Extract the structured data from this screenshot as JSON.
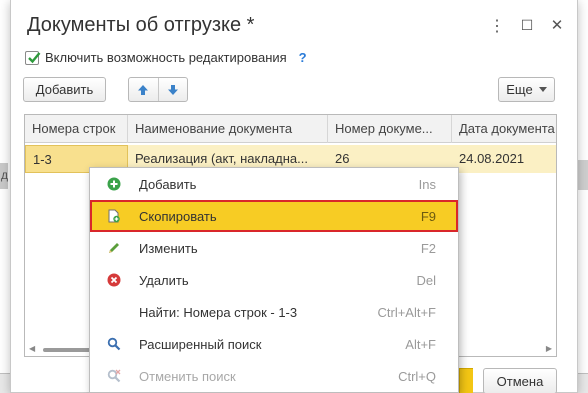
{
  "dialog": {
    "title": "Документы об отгрузке *",
    "window_buttons": {
      "more": "⋮",
      "maximize": "☐",
      "close": "✕"
    }
  },
  "options": {
    "enable_editing_label": "Включить возможность редактирования",
    "enable_editing_checked": true,
    "help_symbol": "?"
  },
  "toolbar": {
    "add_label": "Добавить",
    "more_label": "Еще",
    "more_icon": "caret-down-icon",
    "move_up_icon": "arrow-up-icon",
    "move_down_icon": "arrow-down-icon"
  },
  "table": {
    "columns": [
      "Номера строк",
      "Наименование документа",
      "Номер докуме...",
      "Дата документа"
    ],
    "rows": [
      [
        "1-3",
        "Реализация (акт, накладна...",
        "26",
        "24.08.2021"
      ]
    ]
  },
  "background": {
    "left_fragment": "д"
  },
  "buttons": {
    "cancel_label": "Отмена"
  },
  "context_menu": {
    "items": [
      {
        "label": "Добавить",
        "shortcut": "Ins",
        "icon": "plus-circle-icon",
        "state": "normal"
      },
      {
        "label": "Скопировать",
        "shortcut": "F9",
        "icon": "copy-document-icon",
        "state": "active"
      },
      {
        "label": "Изменить",
        "shortcut": "F2",
        "icon": "pencil-icon",
        "state": "normal"
      },
      {
        "label": "Удалить",
        "shortcut": "Del",
        "icon": "delete-circle-icon",
        "state": "normal"
      },
      {
        "label": "Найти: Номера строк - 1-3",
        "shortcut": "Ctrl+Alt+F",
        "icon": "",
        "state": "normal"
      },
      {
        "label": "Расширенный поиск",
        "shortcut": "Alt+F",
        "icon": "search-icon",
        "state": "normal"
      },
      {
        "label": "Отменить поиск",
        "shortcut": "Ctrl+Q",
        "icon": "cancel-search-icon",
        "state": "disabled"
      }
    ]
  },
  "colors": {
    "selection_row": "#fbf0c4",
    "active_menu_item": "#f7cc24",
    "active_menu_outline": "#d9262a",
    "help_blue": "#2a7bd8"
  }
}
